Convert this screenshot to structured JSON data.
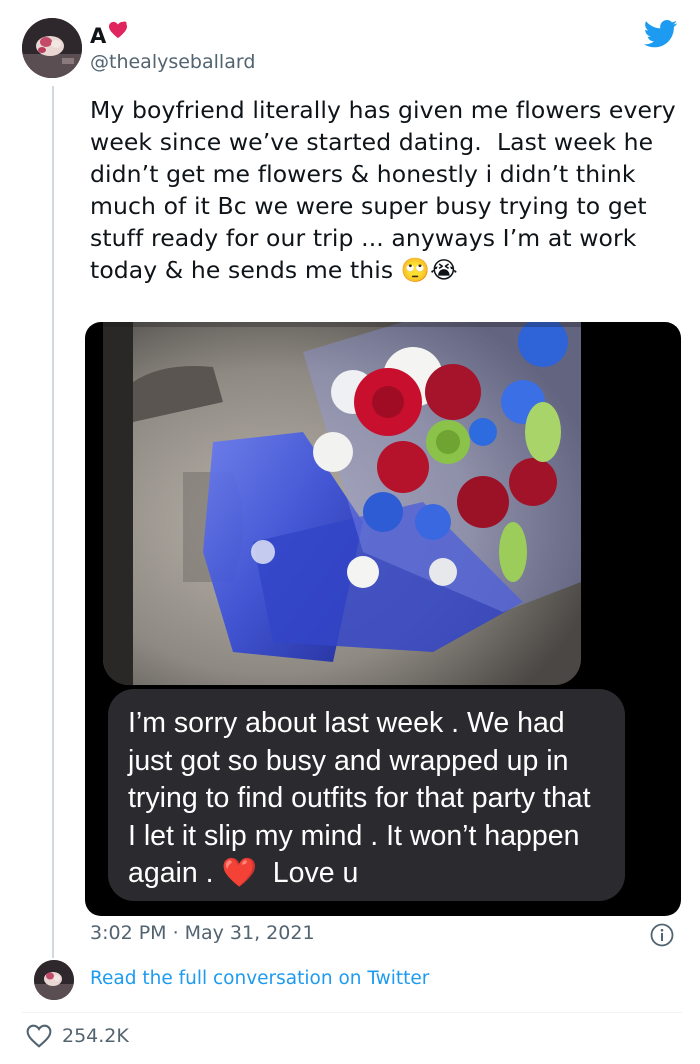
{
  "author": {
    "display_name": "A",
    "badge_icon": "heart-icon",
    "handle": "@thealyseballard"
  },
  "tweet": {
    "text": "My boyfriend literally has given me flowers every week since we’ve started dating.  Last week he didn’t get me flowers & honestly i didn’t think much of it Bc we were super busy trying to get stuff ready for our trip ... anyways I’m at work  today & he sends me this 🙄😭"
  },
  "media": {
    "message_text": "I’m sorry about last week . We had just got so busy and wrapped up in trying to find outfits for that party that I let it slip my mind . It won’t happen again . ❤️  Love u"
  },
  "meta": {
    "time": "3:02 PM",
    "separator": "·",
    "date": "May 31, 2021"
  },
  "footer": {
    "read_link": "Read the full conversation on Twitter",
    "likes": "254.2K"
  },
  "colors": {
    "twitter_blue": "#1d9bf0",
    "text_primary": "#0f1419",
    "text_secondary": "#536471"
  }
}
